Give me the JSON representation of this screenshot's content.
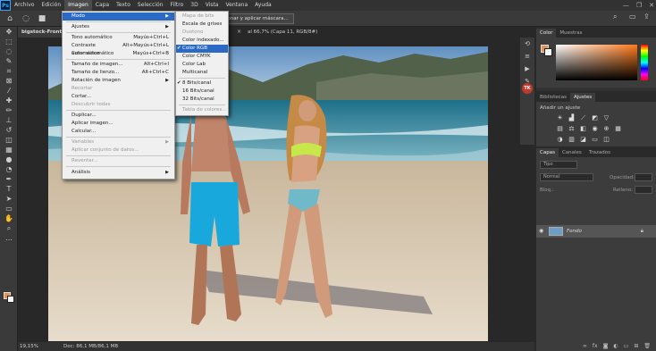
{
  "menubar": {
    "logo": "Ps",
    "items": [
      "Archivo",
      "Edición",
      "Imagen",
      "Capa",
      "Texto",
      "Selección",
      "Filtro",
      "3D",
      "Vista",
      "Ventana",
      "Ayuda"
    ],
    "active": "Imagen"
  },
  "options": {
    "mask_button": "Seleccionar y aplicar máscara..."
  },
  "document": {
    "tab_label": "bigstock-Front-vi",
    "tab_suffix": "al 66,7% (Capa 11, RGB/8#)"
  },
  "imagen_menu": {
    "items": [
      {
        "label": "Modo",
        "shortcut": "",
        "submenu": true,
        "highlight": true
      },
      {
        "label": "Ajustes",
        "shortcut": "",
        "submenu": true
      },
      {
        "label": "Tono automático",
        "shortcut": "Mayús+Ctrl+L"
      },
      {
        "label": "Contraste automático",
        "shortcut": "Alt+Mayús+Ctrl+L"
      },
      {
        "label": "Color automático",
        "shortcut": "Mayús+Ctrl+B"
      },
      {
        "label": "Tamaño de imagen...",
        "shortcut": "Alt+Ctrl+I"
      },
      {
        "label": "Tamaño de lienzo...",
        "shortcut": "Alt+Ctrl+C"
      },
      {
        "label": "Rotación de imagen",
        "shortcut": "",
        "submenu": true
      },
      {
        "label": "Recortar",
        "shortcut": "",
        "disabled": true
      },
      {
        "label": "Cortar...",
        "shortcut": ""
      },
      {
        "label": "Descubrir todas",
        "shortcut": "",
        "disabled": true
      },
      {
        "label": "Duplicar...",
        "shortcut": ""
      },
      {
        "label": "Aplicar imagen...",
        "shortcut": ""
      },
      {
        "label": "Calcular...",
        "shortcut": ""
      },
      {
        "label": "Variables",
        "shortcut": "",
        "submenu": true,
        "disabled": true
      },
      {
        "label": "Aplicar conjunto de datos...",
        "shortcut": "",
        "disabled": true
      },
      {
        "label": "Reventar...",
        "shortcut": "",
        "disabled": true
      },
      {
        "label": "Análisis",
        "shortcut": "",
        "submenu": true
      }
    ]
  },
  "modo_menu": {
    "items": [
      {
        "label": "Mapa de bits",
        "disabled": true
      },
      {
        "label": "Escala de grises"
      },
      {
        "label": "Duotono",
        "disabled": true
      },
      {
        "label": "Color indexado..."
      },
      {
        "label": "Color RGB",
        "checked": true,
        "highlight": true
      },
      {
        "label": "Color CMYK"
      },
      {
        "label": "Color Lab"
      },
      {
        "label": "Multicanal"
      },
      {
        "label": "8 Bits/canal",
        "checked": true
      },
      {
        "label": "16 Bits/canal"
      },
      {
        "label": "32 Bits/canal"
      },
      {
        "label": "Tabla de colores...",
        "disabled": true
      }
    ]
  },
  "status": {
    "zoom": "19,15%",
    "doc": "Doc: 86,1 MB/86,1 MB"
  },
  "panels": {
    "color_tabs": [
      "Color",
      "Muestras"
    ],
    "adjust_tabs": [
      "Bibliotecas",
      "Ajustes"
    ],
    "adjust_label": "Añadir un ajuste",
    "layers_tabs": [
      "Capas",
      "Canales",
      "Trazados"
    ],
    "kind_label": "Tipo",
    "blend_label": "Normal",
    "opacity_label": "Opacidad:",
    "lock_label": "Bloq.:",
    "fill_label": "Relleno:",
    "layer_name": "Fondo"
  },
  "colors": {
    "foreground": "#e8924f",
    "accent": "#2a6ac4"
  }
}
